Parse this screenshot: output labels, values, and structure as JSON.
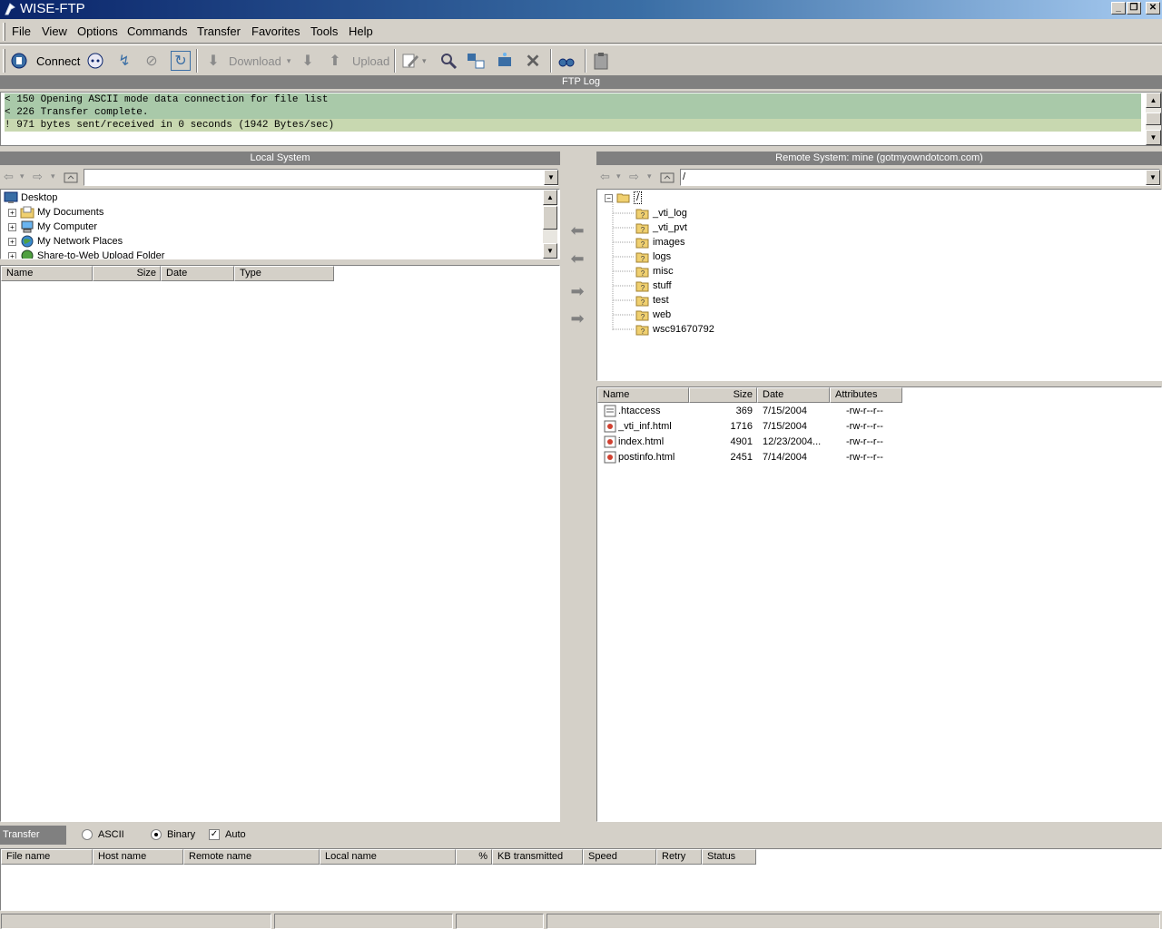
{
  "window": {
    "title": "WISE-FTP",
    "minimize": "_",
    "restore": "❐",
    "close": "✕"
  },
  "menu": [
    "File",
    "View",
    "Options",
    "Commands",
    "Transfer",
    "Favorites",
    "Tools",
    "Help"
  ],
  "toolbar": {
    "connect_label": "Connect",
    "download_label": "Download",
    "upload_label": "Upload"
  },
  "ftp_log": {
    "header": "FTP Log",
    "lines": [
      "< 150 Opening ASCII mode data connection for file list",
      "< 226 Transfer complete.",
      "! 971 bytes sent/received in 0 seconds (1942 Bytes/sec)"
    ],
    "colors": {
      "line_bg": "#a9c9a9",
      "last_line_bg": "#c8d8b0"
    }
  },
  "local": {
    "header": "Local System",
    "address": "",
    "tree": [
      "Desktop",
      "My Documents",
      "My Computer",
      "My Network Places",
      "Share-to-Web Upload Folder"
    ],
    "columns": [
      "Name",
      "Size",
      "Date",
      "Type"
    ]
  },
  "remote": {
    "header": "Remote System: mine (gotmyowndotcom.com)",
    "address": "/",
    "tree_root": "/",
    "tree": [
      "_vti_log",
      "_vti_pvt",
      "images",
      "logs",
      "misc",
      "stuff",
      "test",
      "web",
      "wsc91670792"
    ],
    "columns": [
      "Name",
      "Size",
      "Date",
      "Attributes"
    ],
    "files": [
      {
        "name": ".htaccess",
        "size": "369",
        "date": "7/15/2004",
        "attributes": "-rw-r--r--"
      },
      {
        "name": "_vti_inf.html",
        "size": "1716",
        "date": "7/15/2004",
        "attributes": "-rw-r--r--"
      },
      {
        "name": "index.html",
        "size": "4901",
        "date": "12/23/2004...",
        "attributes": "-rw-r--r--"
      },
      {
        "name": "postinfo.html",
        "size": "2451",
        "date": "7/14/2004",
        "attributes": "-rw-r--r--"
      }
    ]
  },
  "transfer_mode": {
    "label": "Transfer Mode",
    "ascii": "ASCII",
    "binary": "Binary",
    "auto": "Auto",
    "selected": "Binary",
    "auto_checked": true
  },
  "queue": {
    "columns": [
      "File name",
      "Host name",
      "Remote name",
      "Local name",
      "%",
      "KB transmitted",
      "Speed",
      "Retry",
      "Status"
    ]
  },
  "icons": {
    "arrow_left": "⇦",
    "arrow_right": "⇨",
    "dropdown": "▾",
    "up_arrow": "▲",
    "down_arrow": "▼",
    "plus": "+",
    "minus": "−",
    "check": "✓",
    "download": "⬇",
    "upload": "⬆",
    "disconnect": "↯",
    "stop": "⊘",
    "refresh": "↻",
    "search": "🔍",
    "delete": "✕",
    "transfer_left": "⬅",
    "transfer_right": "➡"
  }
}
